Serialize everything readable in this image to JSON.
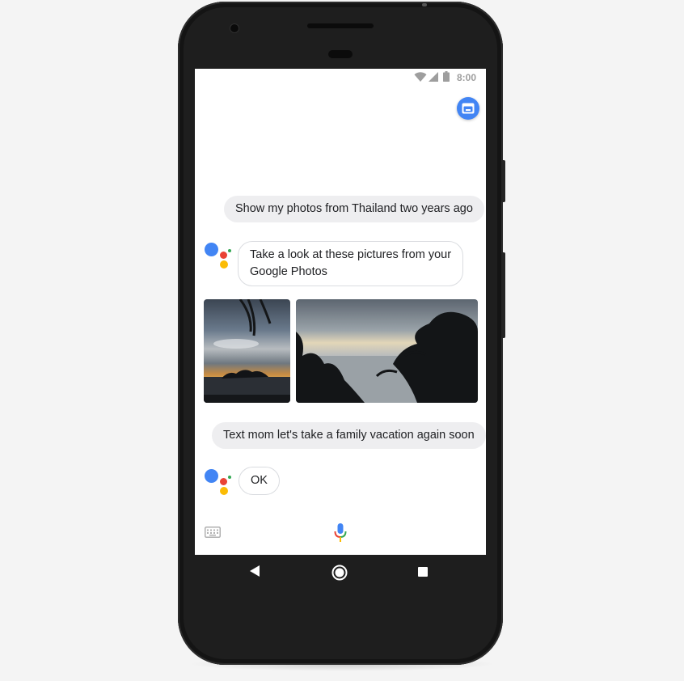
{
  "status_bar": {
    "time": "8:00"
  },
  "conversation": {
    "user_query_1": "Show my photos from Thailand two years ago",
    "assistant_reply_1_line1": "Take a look at these pictures from your",
    "assistant_reply_1_line2": "Google Photos",
    "user_query_2": "Text mom let's take a family vacation again soon",
    "assistant_reply_2": "OK"
  },
  "icons": {
    "fab": "assistant-panel-icon",
    "keyboard": "keyboard-icon",
    "mic": "mic-icon",
    "nav": [
      "back-icon",
      "home-icon",
      "recents-icon"
    ]
  },
  "colors": {
    "google_blue": "#4285f4",
    "google_red": "#ea4335",
    "google_yellow": "#fbbc05",
    "google_green": "#34a853",
    "phone_body": "#1e1e1e"
  }
}
